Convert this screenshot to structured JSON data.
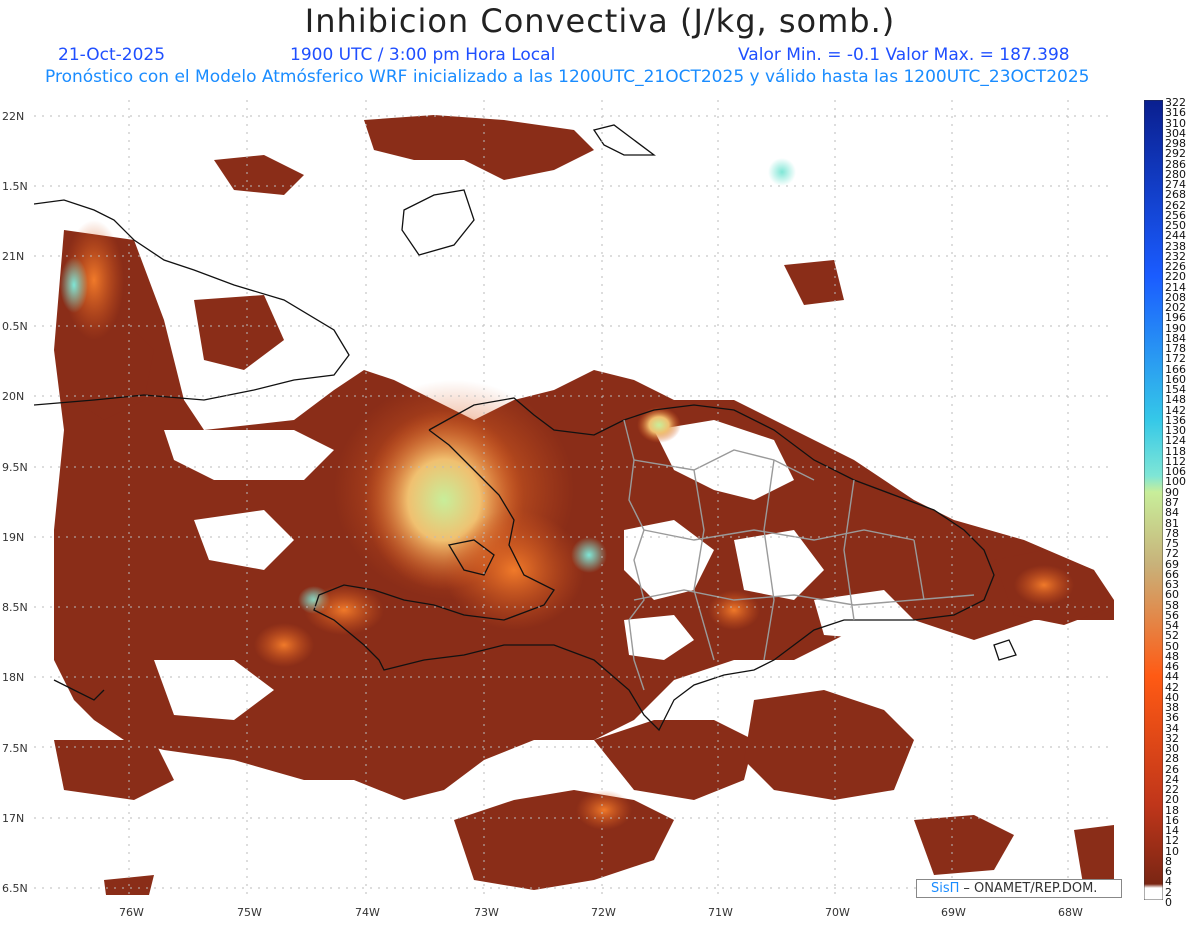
{
  "header": {
    "title": "Inhibicion Convectiva (J/kg, somb.)",
    "date": "21-Oct-2025",
    "time": "1900 UTC / 3:00 pm Hora Local",
    "minmax": "Valor Min. = -0.1  Valor Max. = 187.398",
    "forecast": "Pronóstico con el Modelo Atmósferico WRF inicializado a las 1200UTC_21OCT2025 y válido hasta las  1200UTC_23OCT2025"
  },
  "axes": {
    "lat_labels": [
      "22N",
      "1.5N",
      "21N",
      "0.5N",
      "20N",
      "9.5N",
      "19N",
      "8.5N",
      "18N",
      "7.5N",
      "17N",
      "6.5N"
    ],
    "lon_labels": [
      "76W",
      "75W",
      "74W",
      "73W",
      "72W",
      "71W",
      "70W",
      "69W",
      "68W"
    ]
  },
  "colorbar": {
    "labels": [
      "322",
      "316",
      "310",
      "304",
      "298",
      "292",
      "286",
      "280",
      "274",
      "268",
      "262",
      "256",
      "250",
      "244",
      "238",
      "232",
      "226",
      "220",
      "214",
      "208",
      "202",
      "196",
      "190",
      "184",
      "178",
      "172",
      "166",
      "160",
      "154",
      "148",
      "142",
      "136",
      "130",
      "124",
      "118",
      "112",
      "106",
      "100",
      "90",
      "87",
      "84",
      "81",
      "78",
      "75",
      "72",
      "69",
      "66",
      "63",
      "60",
      "58",
      "56",
      "54",
      "52",
      "50",
      "48",
      "46",
      "44",
      "42",
      "40",
      "38",
      "36",
      "34",
      "32",
      "30",
      "28",
      "26",
      "24",
      "22",
      "20",
      "18",
      "16",
      "14",
      "12",
      "10",
      "8",
      "6",
      "4",
      "2",
      "0"
    ],
    "colors": {
      "top": "#0a1f8f",
      "blue": "#1a5cff",
      "cyan": "#35c8e8",
      "teal": "#7fe6d6",
      "green": "#c8ee9a",
      "tan": "#c8b27a",
      "orange": "#ff5a14",
      "rust": "#c0361a",
      "dark": "#7a2614",
      "zero": "#ffffff"
    }
  },
  "credit": {
    "brand": "SisΠ",
    "text": "– ONAMET/REP.DOM."
  },
  "map_colors": {
    "low": "#8a2d18",
    "mid": "#d2561e",
    "high": "#f0c070",
    "peak": "#c8ee9a",
    "coast": "#111111",
    "border": "#9a9a9a"
  }
}
